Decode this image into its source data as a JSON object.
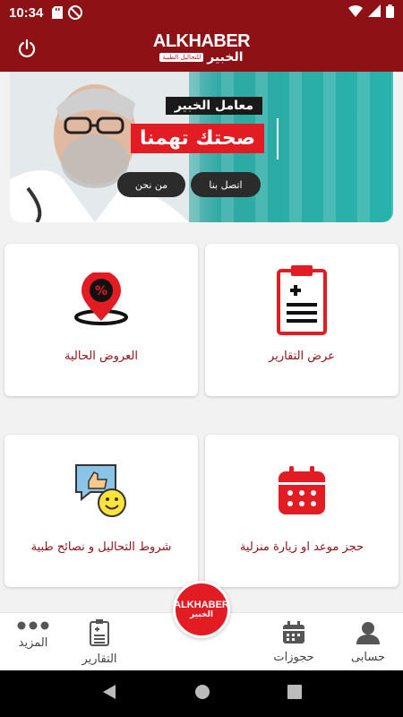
{
  "status_bar": {
    "time": "10:34"
  },
  "header": {
    "logo_en": "ALKHABER",
    "logo_ar": "الخبير",
    "logo_tag": "للتحاليل الطبية"
  },
  "banner": {
    "title": "معامل الخبير",
    "slogan": "صحتك تهمنا",
    "contact_label": "اتصل بنا",
    "about_label": "من نحن"
  },
  "cards": {
    "reports": "عرض التقارير",
    "offers": "العروض الحالية",
    "booking": "حجز موعد او زيارة منزلية",
    "tips": "شروط التحاليل و نصائح طبية"
  },
  "bottom_nav": {
    "account": "حسابى",
    "bookings": "حجوزات",
    "reports": "التقارير",
    "more": "المزيد",
    "center_en": "ALKHABER",
    "center_ar": "الخبير"
  },
  "colors": {
    "brand_dark": "#8e1116",
    "brand_red": "#e31b23",
    "teal": "#2fa9a4"
  }
}
